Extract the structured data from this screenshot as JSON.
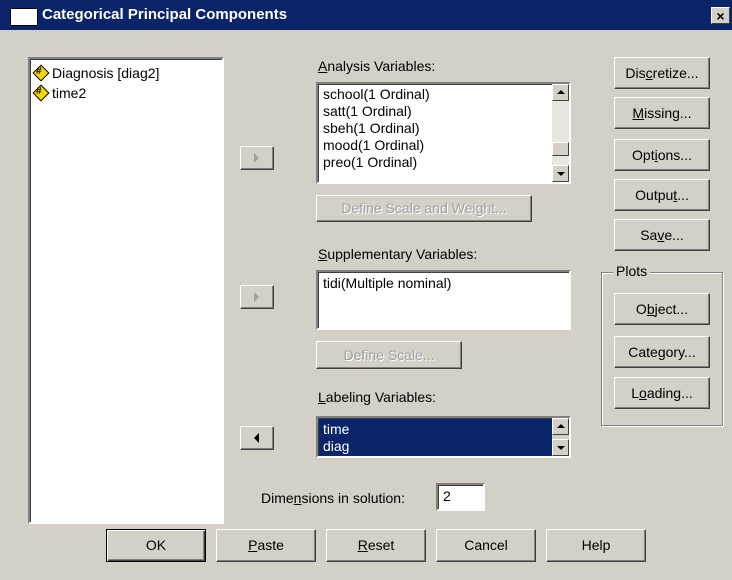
{
  "window": {
    "title": "Categorical Principal Components",
    "close": "×"
  },
  "source_list": {
    "items": [
      {
        "label": "Diagnosis [diag2]",
        "icon": "nominal-variable-icon"
      },
      {
        "label": "time2",
        "icon": "nominal-variable-icon"
      }
    ]
  },
  "analysis": {
    "label": "Analysis Variables:",
    "items": [
      "school(1 Ordinal)",
      "satt(1 Ordinal)",
      "sbeh(1 Ordinal)",
      "mood(1 Ordinal)",
      "preo(1 Ordinal)"
    ],
    "define_button": "Define Scale and Weight..."
  },
  "supplementary": {
    "label": "Supplementary Variables:",
    "items": [
      "tidi(Multiple nominal)"
    ],
    "define_button": "Define Scale..."
  },
  "labeling": {
    "label": "Labeling Variables:",
    "items": [
      "time",
      "diag"
    ]
  },
  "dimensions": {
    "label": "Dimensions in solution:",
    "value": "2"
  },
  "side_buttons": {
    "discretize": "Discretize...",
    "missing": "Missing...",
    "options": "Options...",
    "output": "Output...",
    "save": "Save..."
  },
  "plots": {
    "legend": "Plots",
    "object": "Object...",
    "category": "Category...",
    "loading": "Loading..."
  },
  "bottom_buttons": {
    "ok": "OK",
    "paste": "Paste",
    "reset": "Reset",
    "cancel": "Cancel",
    "help": "Help"
  }
}
